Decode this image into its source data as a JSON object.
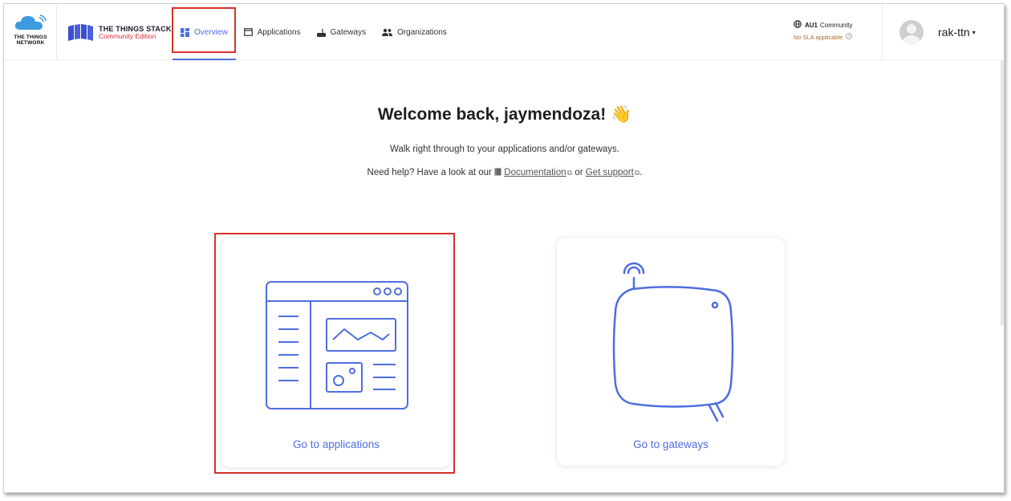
{
  "header": {
    "ttn_logo_text": "THE THINGS NETWORK",
    "stack_title": "THE THINGS STACK",
    "stack_edition": "Community Edition",
    "nav": [
      {
        "label": "Overview",
        "icon": "dashboard-icon",
        "active": true
      },
      {
        "label": "Applications",
        "icon": "window-icon",
        "active": false
      },
      {
        "label": "Gateways",
        "icon": "gateway-icon",
        "active": false
      },
      {
        "label": "Organizations",
        "icon": "people-icon",
        "active": false
      }
    ],
    "cluster": {
      "region": "AU1",
      "tier": "Community",
      "sla": "No SLA applicable"
    },
    "user": {
      "name": "rak-ttn"
    }
  },
  "main": {
    "welcome": "Welcome back, jaymendoza! 👋",
    "subtitle": "Walk right through to your applications and/or gateways.",
    "help_prefix": "Need help? Have a look at our",
    "doc_link": "Documentation",
    "help_or": "or",
    "support_link": "Get support",
    "help_suffix": ".",
    "cards": {
      "applications": "Go to applications",
      "gateways": "Go to gateways"
    }
  },
  "colors": {
    "accent": "#4f6ee0",
    "highlight": "#d9302b",
    "brand_red": "#e02b3a",
    "sla": "#b06a2a"
  }
}
